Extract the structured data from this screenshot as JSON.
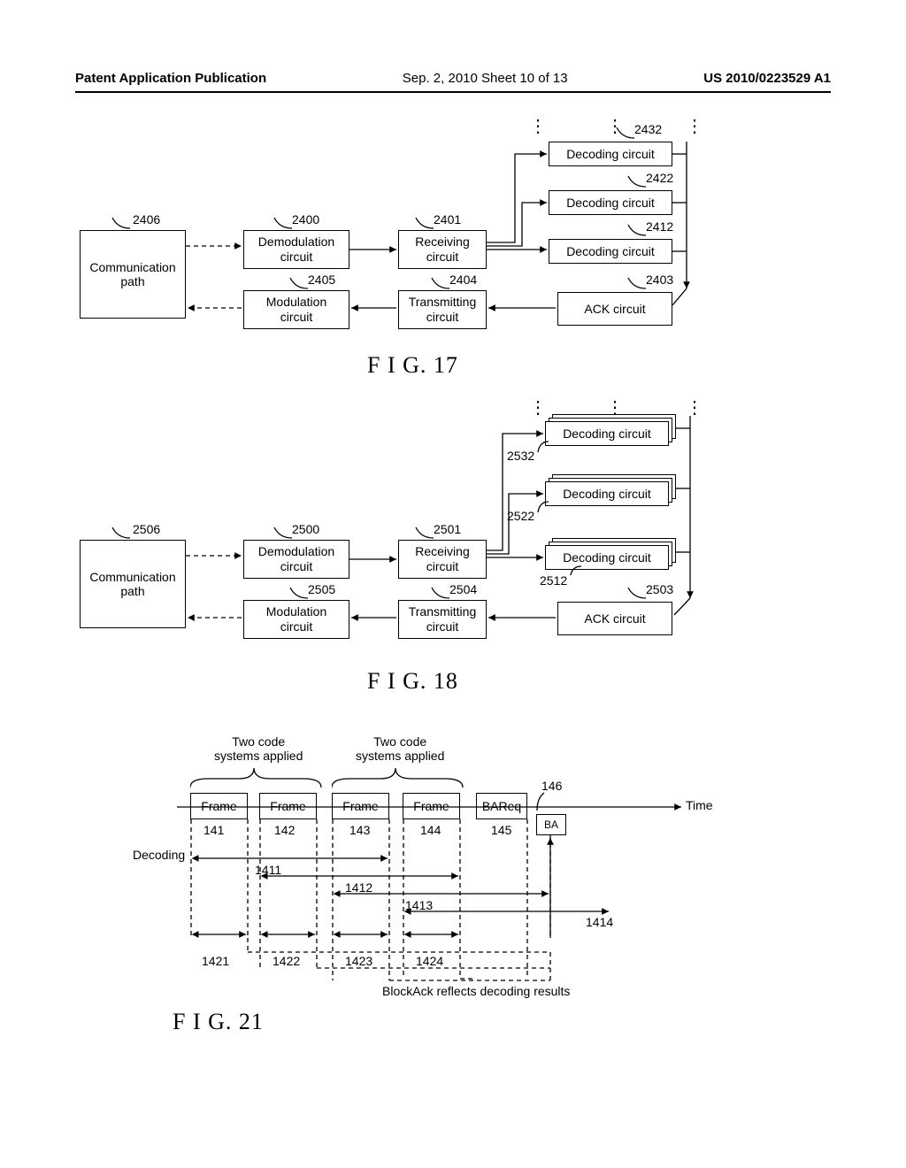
{
  "header": {
    "left": "Patent Application Publication",
    "center": "Sep. 2, 2010  Sheet 10 of 13",
    "right": "US 2010/0223529 A1"
  },
  "fig17": {
    "comm_path": "Communication\npath",
    "demod": "Demodulation\ncircuit",
    "receiving": "Receiving\ncircuit",
    "mod": "Modulation\ncircuit",
    "transmitting": "Transmitting\ncircuit",
    "ack": "ACK circuit",
    "decoding": "Decoding circuit",
    "refs": {
      "comm_path": "2406",
      "demod": "2400",
      "receiving": "2401",
      "mod": "2405",
      "transmitting": "2404",
      "ack": "2403",
      "dec1": "2412",
      "dec2": "2422",
      "dec3": "2432"
    },
    "title": "F I G. 17"
  },
  "fig18": {
    "comm_path": "Communication\npath",
    "demod": "Demodulation\ncircuit",
    "receiving": "Receiving\ncircuit",
    "mod": "Modulation\ncircuit",
    "transmitting": "Transmitting\ncircuit",
    "ack": "ACK circuit",
    "decoding": "Decoding circuit",
    "refs": {
      "comm_path": "2506",
      "demod": "2500",
      "receiving": "2501",
      "mod": "2505",
      "transmitting": "2504",
      "ack": "2503",
      "dec1": "2512",
      "dec2": "2522",
      "dec3": "2532"
    },
    "title": "F I G. 18"
  },
  "fig21": {
    "top_label": "Two code\nsystems applied",
    "frame": "Frame",
    "bareq": "BAReq",
    "ba": "BA",
    "time": "Time",
    "decoding": "Decoding",
    "footer": "BlockAck reflects decoding results",
    "refs": {
      "f141": "141",
      "f142": "142",
      "f143": "143",
      "f144": "144",
      "f145": "145",
      "f146": "146",
      "d1411": "1411",
      "d1412": "1412",
      "d1413": "1413",
      "d1414": "1414",
      "s1421": "1421",
      "s1422": "1422",
      "s1423": "1423",
      "s1424": "1424"
    },
    "title": "F I G. 21"
  }
}
